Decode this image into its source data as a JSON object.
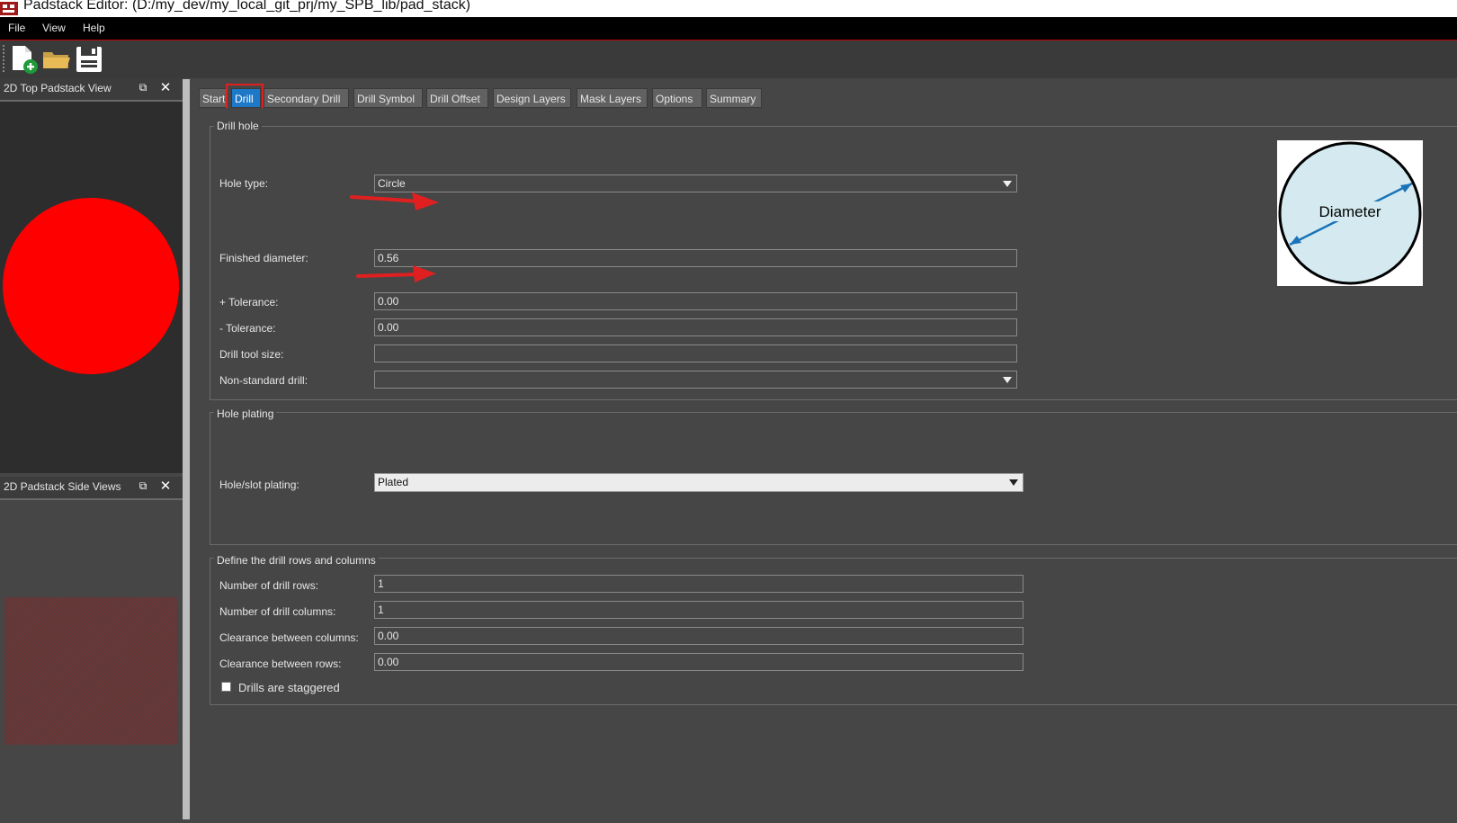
{
  "window": {
    "title": "Padstack Editor:  (D:/my_dev/my_local_git_prj/my_SPB_lib/pad_stack)"
  },
  "menu": [
    "File",
    "View",
    "Help"
  ],
  "toolbar": {
    "buttons": [
      "new-file-icon",
      "open-folder-icon",
      "save-icon"
    ]
  },
  "docks": {
    "top_view_title": "2D Top Padstack View",
    "side_view_title": "2D Padstack Side Views"
  },
  "tabs": [
    "Start",
    "Drill",
    "Secondary Drill",
    "Drill Symbol",
    "Drill Offset",
    "Design Layers",
    "Mask Layers",
    "Options",
    "Summary"
  ],
  "active_tab": "Drill",
  "drill_hole": {
    "group_title": "Drill hole",
    "hole_type_label": "Hole type:",
    "hole_type_value": "Circle",
    "finished_diameter_label": "Finished diameter:",
    "finished_diameter_value": "0.56",
    "plus_tol_label": "+ Tolerance:",
    "plus_tol_value": "0.00",
    "minus_tol_label": "- Tolerance:",
    "minus_tol_value": "0.00",
    "drill_tool_label": "Drill tool size:",
    "drill_tool_value": "",
    "non_std_label": "Non-standard drill:",
    "non_std_value": "",
    "diagram_label": "Diameter"
  },
  "hole_plating": {
    "group_title": "Hole plating",
    "plating_label": "Hole/slot plating:",
    "plating_value": "Plated"
  },
  "drill_rows": {
    "group_title": "Define the drill rows and columns",
    "rows_label": "Number of drill rows:",
    "rows_value": "1",
    "cols_label": "Number of drill columns:",
    "cols_value": "1",
    "clr_cols_label": "Clearance between columns:",
    "clr_cols_value": "0.00",
    "clr_rows_label": "Clearance between rows:",
    "clr_rows_value": "0.00",
    "staggered_label": "Drills are staggered",
    "staggered_checked": false
  },
  "colors": {
    "pad_fill": "#ff0000",
    "active_tab": "#1e78c8",
    "annotation": "#e02020",
    "diagram_fill": "#d4eaf0",
    "diagram_arrow": "#1a73b8"
  }
}
